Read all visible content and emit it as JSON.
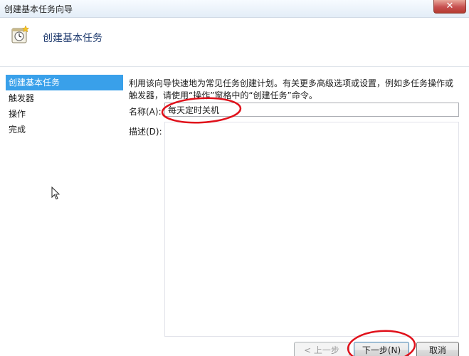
{
  "window": {
    "title": "创建基本任务向导",
    "close_glyph": "✕"
  },
  "header": {
    "title": "创建基本任务"
  },
  "nav": {
    "items": [
      "创建基本任务",
      "触发器",
      "操作",
      "完成"
    ],
    "selected": 0
  },
  "content": {
    "description": "利用该向导快速地为常见任务创建计划。有关更多高级选项或设置，例如多任务操作或触发器，请使用“操作”窗格中的“创建任务”命令。",
    "name_label": "名称(A):",
    "name_value": "每天定时关机",
    "desc_label": "描述(D):",
    "desc_value": ""
  },
  "buttons": {
    "back": "< 上一步(B)",
    "next": "下一步(N) >",
    "cancel": "取消"
  },
  "colors": {
    "accent": "#39a0ea",
    "annotation": "#e0101a"
  }
}
